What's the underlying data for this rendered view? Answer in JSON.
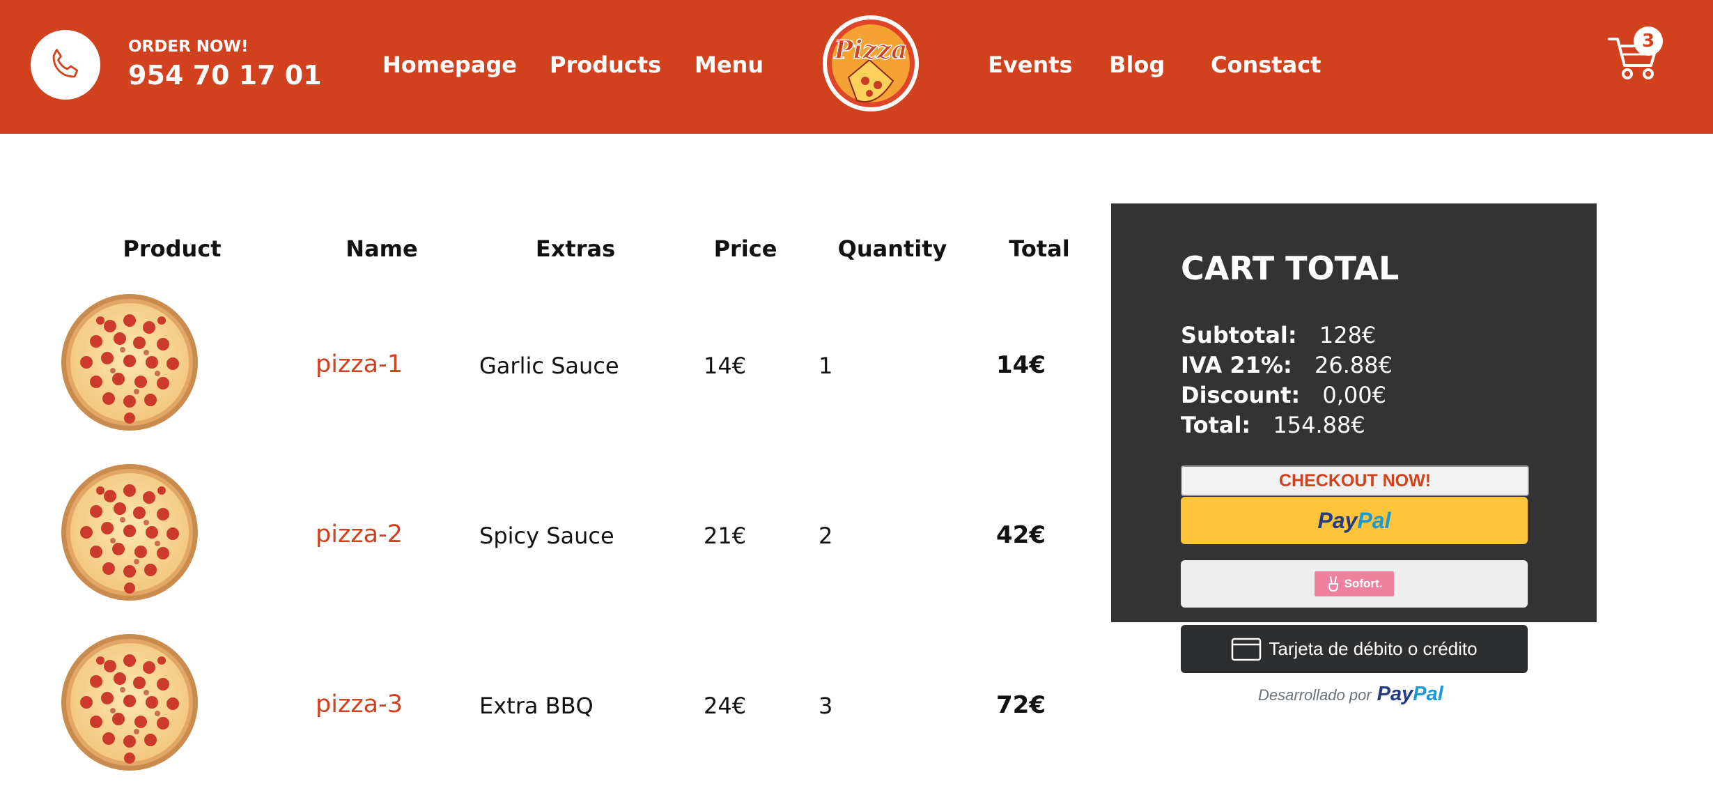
{
  "colors": {
    "brand": "#d1411e",
    "panel": "#333333",
    "paypal_yellow": "#ffc439",
    "sofort_pink": "#ef809f"
  },
  "header": {
    "phone_icon": "phone-icon",
    "order_label": "ORDER NOW!",
    "order_number": "954 70 17 01",
    "nav_left": [
      "Homepage",
      "Products",
      "Menu"
    ],
    "nav_right": [
      "Events",
      "Blog",
      "Constact"
    ],
    "logo_text": "Pizza",
    "cart_icon": "cart-icon",
    "cart_count": "3"
  },
  "table": {
    "columns": [
      "Product",
      "Name",
      "Extras",
      "Price",
      "Quantity",
      "Total"
    ],
    "rows": [
      {
        "image_icon": "pizza-image",
        "name": "pizza-1",
        "extras": "Garlic Sauce",
        "price": "14€",
        "quantity": "1",
        "total": "14€"
      },
      {
        "image_icon": "pizza-image",
        "name": "pizza-2",
        "extras": "Spicy Sauce",
        "price": "21€",
        "quantity": "2",
        "total": "42€"
      },
      {
        "image_icon": "pizza-image",
        "name": "pizza-3",
        "extras": "Extra BBQ",
        "price": "24€",
        "quantity": "3",
        "total": "72€"
      }
    ]
  },
  "cart_total": {
    "title": "CART TOTAL",
    "subtotal_label": "Subtotal:",
    "subtotal_value": "128€",
    "iva_label": "IVA 21%:",
    "iva_value": "26.88€",
    "discount_label": "Discount:",
    "discount_value": "0,00€",
    "total_label": "Total:",
    "total_value": "154.88€",
    "checkout_label": "CHECKOUT NOW!",
    "paypal_pay": "Pay",
    "paypal_pal": "Pal",
    "sofort_label": "Sofort.",
    "card_label": "Tarjeta de débito o crédito",
    "powered_text": "Desarrollado por",
    "powered_pay": "Pay",
    "powered_pal": "Pal"
  }
}
